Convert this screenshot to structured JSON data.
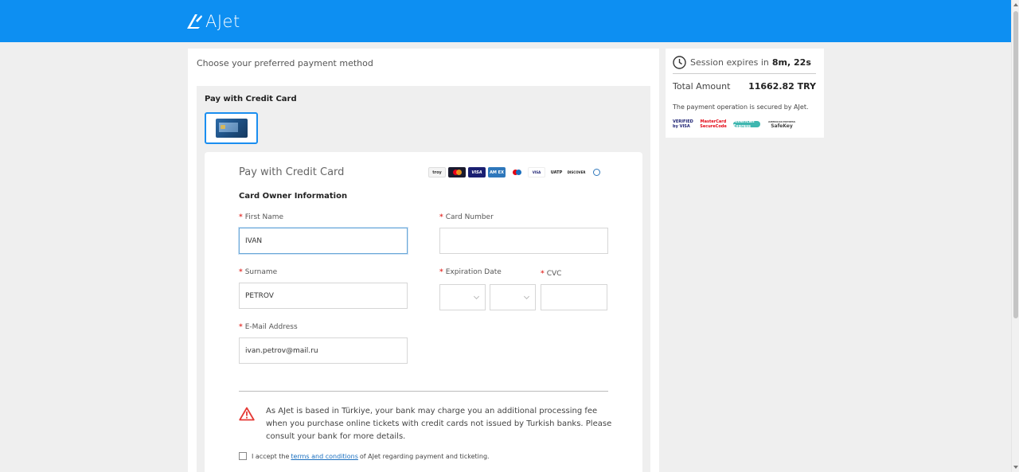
{
  "header": {
    "brand": "AJet",
    "colors": {
      "topbar": "#0d8ff2",
      "accent": "#1a8ef0",
      "required": "#e53935",
      "warning": "#e53935"
    }
  },
  "main": {
    "choose_label": "Choose your preferred payment method",
    "method_title": "Pay with Credit Card",
    "method_tile_icon": "credit-card-icon",
    "form": {
      "title": "Pay with Credit Card",
      "brands": [
        "troy",
        "Mastercard",
        "VISA",
        "American Express",
        "Maestro",
        "Visa Electron",
        "UATP",
        "DISCOVER",
        "Diners Club"
      ],
      "section_title": "Card Owner Information",
      "required_marker": "*",
      "first_name": {
        "label": "First Name",
        "value": "IVAN"
      },
      "surname": {
        "label": "Surname",
        "value": "PETROV"
      },
      "email": {
        "label": "E-Mail Address",
        "value": "ivan.petrov@mail.ru"
      },
      "card_number": {
        "label": "Card Number",
        "value": ""
      },
      "expiration": {
        "label": "Expiration Date",
        "month": "",
        "year": ""
      },
      "cvc": {
        "label": "CVC",
        "value": ""
      },
      "warning": "As AJet is based in Türkiye, your bank may charge you an additional processing fee when you purchase online tickets with credit cards not issued by Turkish banks. Please consult your bank for more details.",
      "terms_prefix": "I accept the",
      "terms_link": "terms and conditions",
      "terms_suffix": "of AJet regarding payment and ticketing."
    }
  },
  "summary": {
    "session_prefix": "Session expires in",
    "session_time": "8m, 22s",
    "total_label": "Total Amount",
    "total_value": "11662.82 TRY",
    "secured_text": "The payment operation is secured by AJet.",
    "security_logos": {
      "visa_line1": "VERIFIED",
      "visa_line2": "by VISA",
      "mc_line1": "MasterCard",
      "mc_line2": "SecureCode",
      "amex": "American Express",
      "safekey_line1": "AMERICAN EXPRESS",
      "safekey_line2": "SafeKey"
    }
  }
}
